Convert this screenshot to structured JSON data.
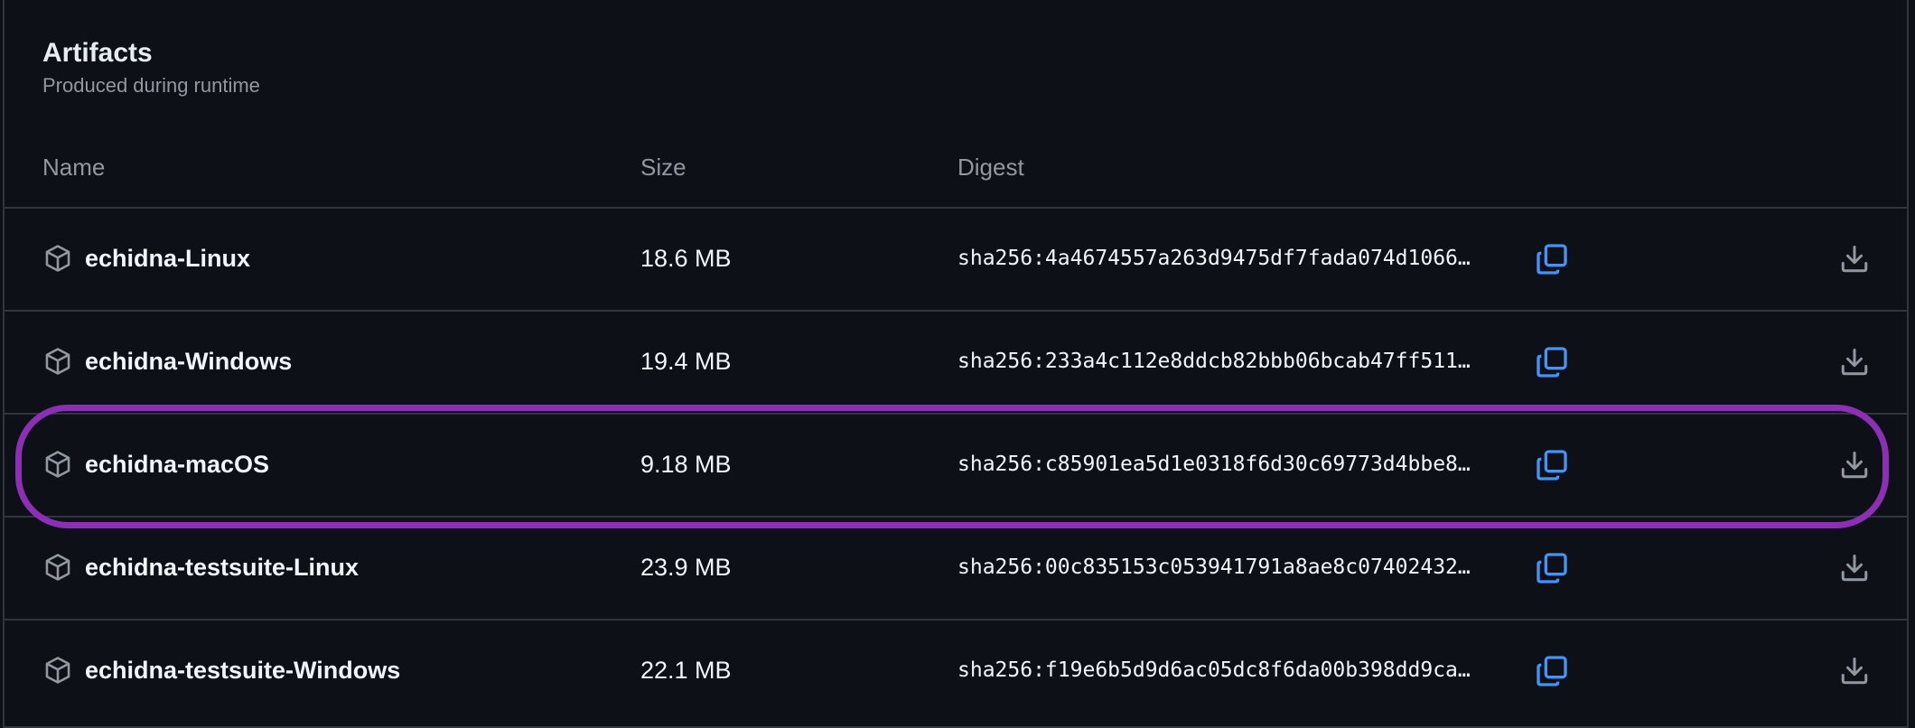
{
  "section": {
    "title": "Artifacts",
    "subtitle": "Produced during runtime"
  },
  "columns": {
    "name": "Name",
    "size": "Size",
    "digest": "Digest"
  },
  "artifacts": [
    {
      "name": "echidna-Linux",
      "size": "18.6 MB",
      "digest": "sha256:4a4674557a263d9475df7fada074d1066…"
    },
    {
      "name": "echidna-Windows",
      "size": "19.4 MB",
      "digest": "sha256:233a4c112e8ddcb82bbb06bcab47ff511…"
    },
    {
      "name": "echidna-macOS",
      "size": "9.18 MB",
      "digest": "sha256:c85901ea5d1e0318f6d30c69773d4bbe8…"
    },
    {
      "name": "echidna-testsuite-Linux",
      "size": "23.9 MB",
      "digest": "sha256:00c835153c053941791a8ae8c07402432…"
    },
    {
      "name": "echidna-testsuite-Windows",
      "size": "22.1 MB",
      "digest": "sha256:f19e6b5d9d6ac05dc8f6da00b398dd9ca…"
    }
  ],
  "icons": {
    "package": "package-icon",
    "copy": "copy-icon",
    "download": "download-icon"
  },
  "colors": {
    "background": "#0d1117",
    "border": "#30363d",
    "muted_text": "#9198a1",
    "accent": "#4493f8",
    "highlight": "#8c2fb5"
  }
}
